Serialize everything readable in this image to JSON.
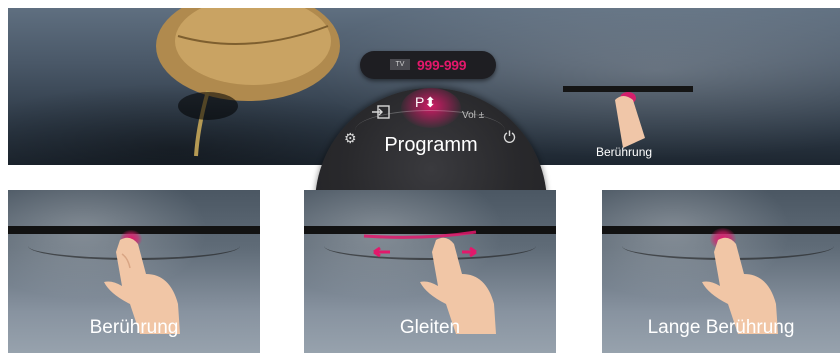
{
  "channel": {
    "source_tag": "TV",
    "number": "999-999"
  },
  "dial": {
    "program_symbol": "P⬍",
    "volume_label": "Vol ±",
    "center_label": "Programm",
    "icons": [
      "input-icon",
      "settings-gear-icon",
      "power-icon"
    ]
  },
  "banner_touch_label": "Berührung",
  "gestures": [
    {
      "label": "Berührung"
    },
    {
      "label": "Gleiten"
    },
    {
      "label": "Lange Berührung"
    }
  ],
  "colors": {
    "accent": "#e2186b",
    "dial_bg": "#29292c"
  }
}
